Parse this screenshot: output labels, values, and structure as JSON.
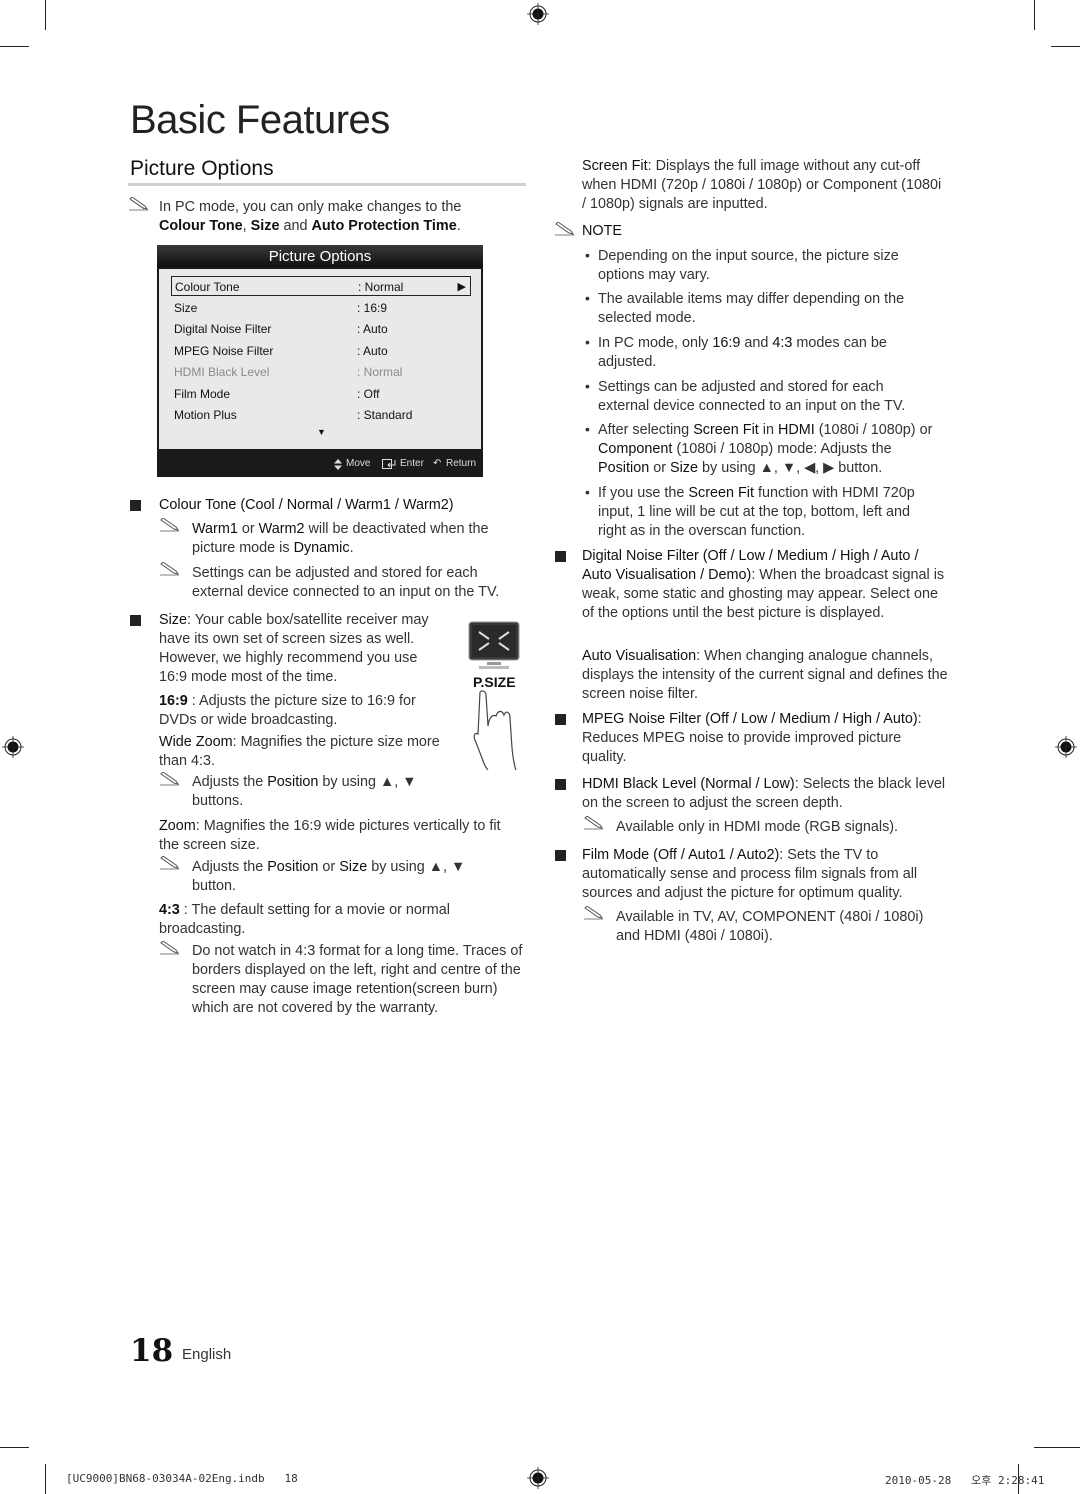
{
  "page": {
    "title": "Basic Features",
    "section_title": "Picture Options",
    "page_number": "18",
    "language": "English",
    "slug_left": "[UC9000]BN68-03034A-02Eng.indb   18",
    "slug_right": "2010-05-28   오후 2:28:41"
  },
  "intro_note": {
    "text_pre": "In PC mode, you can only make changes to the",
    "b1": "Colour Tone",
    "sep1": ", ",
    "b2": "Size",
    "sep2": " and ",
    "b3": "Auto Protection Time",
    "end": "."
  },
  "osd": {
    "title": "Picture Options",
    "rows": [
      {
        "label": "Colour Tone",
        "value": ": Normal",
        "selected": true
      },
      {
        "label": "Size",
        "value": ": 16:9"
      },
      {
        "label": "Digital Noise Filter",
        "value": ": Auto"
      },
      {
        "label": "MPEG Noise Filter",
        "value": ": Auto"
      },
      {
        "label": "HDMI Black Level",
        "value": ": Normal",
        "disabled": true
      },
      {
        "label": "Film Mode",
        "value": ": Off"
      },
      {
        "label": "Motion Plus",
        "value": ": Standard"
      }
    ],
    "right_arrow": "▶",
    "scroll_down": "▼",
    "footer": {
      "move": "Move",
      "enter": "Enter",
      "return": "Return"
    }
  },
  "left_col": {
    "colour_tone_heading": "Colour Tone (Cool / Normal / Warm1 / Warm2)",
    "ct_note1": {
      "b1": "Warm1",
      "t1": " or ",
      "b2": "Warm2",
      "t2": " will be deactivated when the picture mode is ",
      "b3": "Dynamic",
      "t3": "."
    },
    "ct_note2": "Settings can be adjusted and stored for each external device connected to an input on the TV.",
    "size_label": "Size",
    "size_text": ": Your cable box/satellite receiver may have its own set of screen sizes as well. However, we highly recommend you use 16:9 mode most of the time.",
    "psize_label": "P.SIZE",
    "r169_b": "16:9",
    "r169_t": " : Adjusts the picture size to 16:9 for DVDs or wide broadcasting.",
    "wz_b": "Wide Zoom",
    "wz_t": ": Magnifies the picture size more than 4:3.",
    "wz_note": {
      "t1": "Adjusts the ",
      "b1": "Position",
      "t2": " by using ▲, ▼ buttons."
    },
    "zoom_b": "Zoom",
    "zoom_t": ": Magnifies the 16:9 wide pictures vertically to fit the screen size.",
    "zoom_note": {
      "t1": "Adjusts the ",
      "b1": "Position",
      "t2": " or ",
      "b2": "Size",
      "t3": " by using ▲, ▼ button."
    },
    "r43_b": "4:3",
    "r43_t": " : The default setting for a movie or normal broadcasting.",
    "r43_note": "Do not watch in 4:3 format for a long time. Traces of borders displayed on the left, right and centre of the screen may cause image retention(screen burn) which are not covered by the warranty."
  },
  "right_col": {
    "sf_b": "Screen Fit",
    "sf_t": ": Displays the full image without any cut-off when HDMI (720p / 1080i / 1080p) or Component (1080i / 1080p) signals are inputted.",
    "note_heading": "NOTE",
    "bullets": {
      "b1": "Depending on the input source, the picture size options may vary.",
      "b2": "The available items may differ depending on the selected mode.",
      "b3": {
        "t1": "In PC mode, only ",
        "b1": "16:9",
        "t2": " and ",
        "b2": "4:3",
        "t3": " modes can be adjusted."
      },
      "b4": "Settings can be adjusted and stored for each external device connected to an input on the TV.",
      "b5": {
        "t1": "After selecting ",
        "b1": "Screen Fit",
        "t2": " in ",
        "b2": "HDMI",
        "t3": " (1080i / 1080p) or ",
        "b3": "Component",
        "t4": " (1080i / 1080p) mode: Adjusts the ",
        "b4": "Position",
        "t5": " or ",
        "b5": "Size",
        "t6": " by using ▲, ▼, ◀, ▶ button."
      },
      "b6": {
        "t1": "If you use the ",
        "b1": "Screen Fit",
        "t2": " function with HDMI 720p input, 1 line will be cut at the top, bottom, left and right as in the overscan function."
      }
    },
    "dnf_b": "Digital Noise Filter (Off / Low / Medium / High / Auto / Auto Visualisation / Demo)",
    "dnf_t": ": When the broadcast signal is weak, some static and ghosting may appear. Select one of the options until the best picture is displayed.",
    "av_b": "Auto Visualisation",
    "av_t": ": When changing analogue channels, displays the intensity of the current signal and defines the screen noise filter.",
    "mpeg_b": "MPEG Noise Filter (Off / Low / Medium / High / Auto)",
    "mpeg_t": ": Reduces MPEG noise to provide improved picture quality.",
    "hdmi_b": "HDMI Black Level (Normal / Low)",
    "hdmi_t": ": Selects the black level on the screen to adjust the screen depth.",
    "hdmi_note": "Available only in HDMI mode (RGB signals).",
    "film_b": "Film Mode (Off / Auto1 / Auto2)",
    "film_t": ": Sets the TV to automatically sense and process film signals from all sources and adjust the picture for optimum quality.",
    "film_note": "Available in TV, AV, COMPONENT (480i / 1080i) and HDMI (480i / 1080i)."
  }
}
